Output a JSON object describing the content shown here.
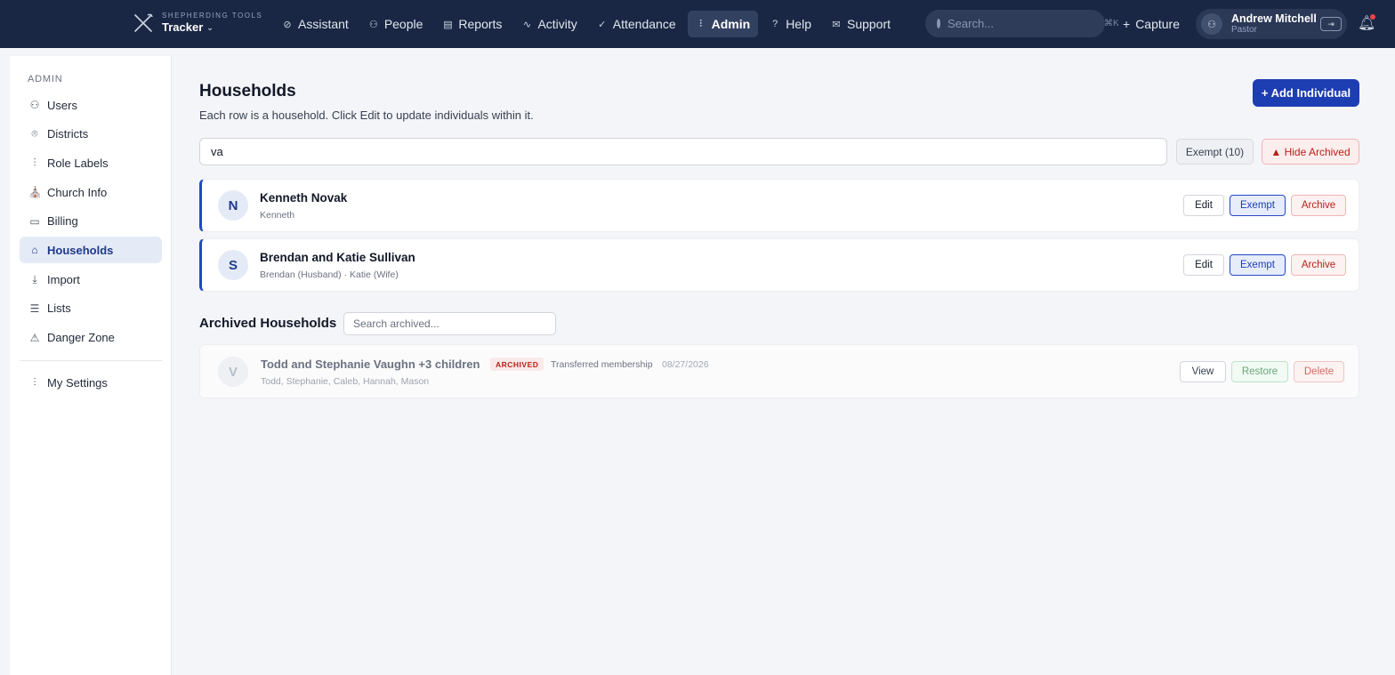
{
  "brand": {
    "subtitle": "SHEPHERDING TOOLS",
    "name": "Tracker",
    "caret": "⌄"
  },
  "nav": [
    {
      "label": "Assistant",
      "icon": "compass-icon",
      "glyph": "⊘",
      "active": false
    },
    {
      "label": "People",
      "icon": "people-icon",
      "glyph": "⚇",
      "active": false
    },
    {
      "label": "Reports",
      "icon": "document-icon",
      "glyph": "▤",
      "active": false
    },
    {
      "label": "Activity",
      "icon": "activity-icon",
      "glyph": "∿",
      "active": false
    },
    {
      "label": "Attendance",
      "icon": "check-icon",
      "glyph": "✓",
      "active": false
    },
    {
      "label": "Admin",
      "icon": "sliders-icon",
      "glyph": "⫶",
      "active": true
    },
    {
      "label": "Help",
      "icon": "help-icon",
      "glyph": "?",
      "active": false
    },
    {
      "label": "Support",
      "icon": "mail-icon",
      "glyph": "✉",
      "active": false
    }
  ],
  "search": {
    "placeholder": "Search...",
    "shortcut": "⌘K"
  },
  "capture": {
    "label": "Capture",
    "glyph": "+"
  },
  "user": {
    "name": "Andrew Mitchell",
    "role": "Pastor"
  },
  "sidebar": {
    "section": "ADMIN",
    "items": [
      {
        "label": "Users",
        "icon": "users-icon",
        "glyph": "⚇",
        "active": false
      },
      {
        "label": "Districts",
        "icon": "map-pin-icon",
        "glyph": "⌾",
        "active": false
      },
      {
        "label": "Role Labels",
        "icon": "sliders-icon",
        "glyph": "⫶",
        "active": false
      },
      {
        "label": "Church Info",
        "icon": "church-icon",
        "glyph": "⛪",
        "active": false
      },
      {
        "label": "Billing",
        "icon": "credit-card-icon",
        "glyph": "▭",
        "active": false
      },
      {
        "label": "Households",
        "icon": "home-icon",
        "glyph": "⌂",
        "active": true
      },
      {
        "label": "Import",
        "icon": "download-icon",
        "glyph": "⤓",
        "active": false
      },
      {
        "label": "Lists",
        "icon": "list-icon",
        "glyph": "☰",
        "active": false
      },
      {
        "label": "Danger Zone",
        "icon": "warning-icon",
        "glyph": "⚠",
        "active": false
      }
    ],
    "settings": {
      "label": "My Settings",
      "icon": "sliders-icon",
      "glyph": "⫶"
    }
  },
  "main": {
    "title": "Households",
    "subtitle": "Each row is a household. Click Edit to update individuals within it.",
    "add_button": "+ Add Individual",
    "filter_value": "va",
    "exempt_filter": "Exempt (10)",
    "hide_archived": "▲ Hide Archived"
  },
  "households": [
    {
      "initial": "N",
      "name": "Kenneth Novak",
      "members": "Kenneth",
      "edit": "Edit",
      "exempt": "Exempt",
      "archive": "Archive"
    },
    {
      "initial": "S",
      "name": "Brendan and Katie Sullivan",
      "members": "Brendan (Husband) · Katie (Wife)",
      "edit": "Edit",
      "exempt": "Exempt",
      "archive": "Archive"
    }
  ],
  "archived": {
    "title": "Archived Households",
    "search_placeholder": "Search archived...",
    "items": [
      {
        "initial": "V",
        "name": "Todd and Stephanie Vaughn +3 children",
        "badge": "ARCHIVED",
        "reason": "Transferred membership",
        "date": "08/27/2026",
        "members": "Todd, Stephanie, Caleb, Hannah, Mason",
        "view": "View",
        "restore": "Restore",
        "delete": "Delete"
      }
    ]
  },
  "colors": {
    "topbar": "#1a2744",
    "accent": "#1d3db3",
    "danger": "#b42318"
  }
}
